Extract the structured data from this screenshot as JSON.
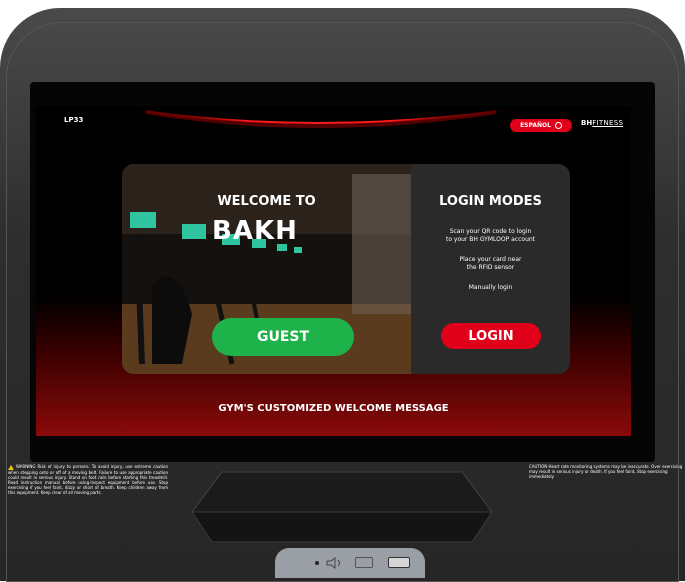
{
  "screen": {
    "model_label": "LP33",
    "language_button": "ESPAÑOL",
    "brand": {
      "bh": "BH",
      "fitness": "FITNESS"
    }
  },
  "welcome": {
    "title": "WELCOME TO",
    "gym_name": "BAKH",
    "guest_button": "GUEST"
  },
  "login": {
    "title": "LOGIN MODES",
    "instruction_1a": "Scan your QR code to login",
    "instruction_1b": "to your BH GYMLOOP account",
    "instruction_2a": "Place your card near",
    "instruction_2b": "the RFID sensor",
    "instruction_3": "Manually login",
    "login_button": "LOGIN"
  },
  "footer_message": "GYM'S CUSTOMIZED WELCOME MESSAGE",
  "labels": {
    "warning_left": "WARNING Risk of injury to persons. To avoid injury, use extreme caution when stepping onto or off of a moving belt. Failure to use appropriate caution could result in serious injury. Stand on foot rails before starting this treadmill. Read instruction manual before using.Inspect equipment before use. Stop exercising if you feel faint, dizzy or short of breath. Keep children away from this equipment. Keep clear of all moving parts.",
    "warning_right": "CAUTION Heart rate monitoring systems may be inaccurate. Over exercising may result in serious injury or death. If you feel faint, Stop exercising immediately"
  },
  "colors": {
    "accent_red": "#e1001a",
    "guest_green": "#1fb24a",
    "panel_dark": "#2a2a2a"
  },
  "icons": [
    "globe-icon",
    "warning-icon",
    "indicator-dot-icon",
    "sound-icon",
    "battery-icon",
    "usb-port-icon"
  ]
}
